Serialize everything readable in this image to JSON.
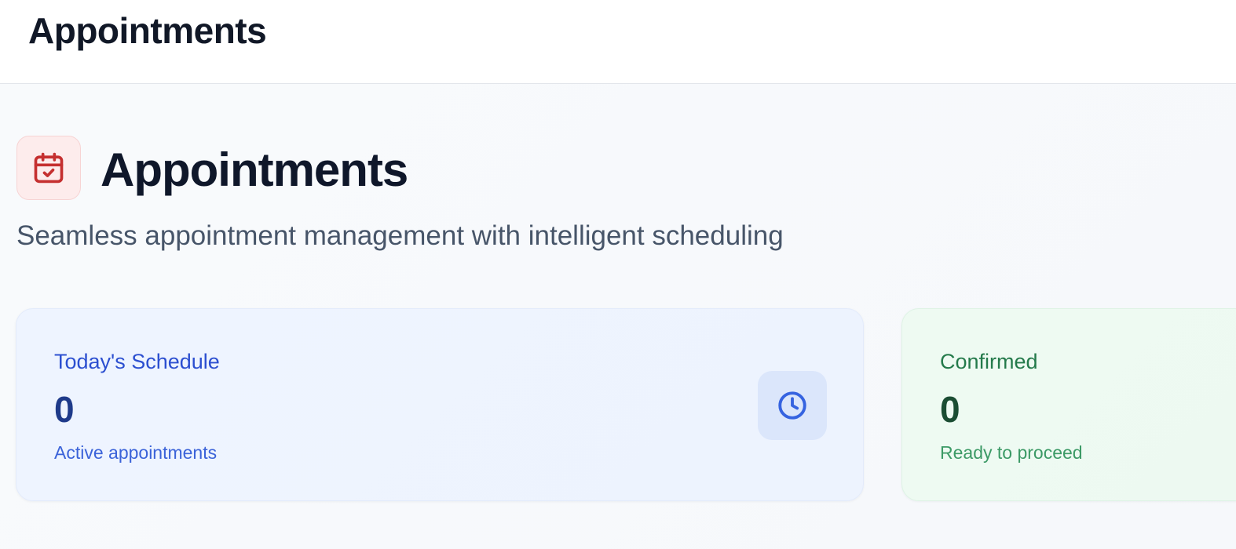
{
  "header": {
    "title": "Appointments"
  },
  "hero": {
    "icon": "calendar-check-icon",
    "title": "Appointments",
    "subtitle": "Seamless appointment management with intelligent scheduling"
  },
  "stats": [
    {
      "label": "Today's Schedule",
      "value": "0",
      "caption": "Active appointments",
      "icon": "clock-icon",
      "accent": "#2c4fd0"
    },
    {
      "label": "Confirmed",
      "value": "0",
      "caption": "Ready to proceed",
      "accent": "#247a4b"
    }
  ],
  "colors": {
    "hero_icon": "#c53030",
    "hero_icon_bg": "#fdecec",
    "heading": "#0f172a",
    "subtitle": "#475569"
  }
}
